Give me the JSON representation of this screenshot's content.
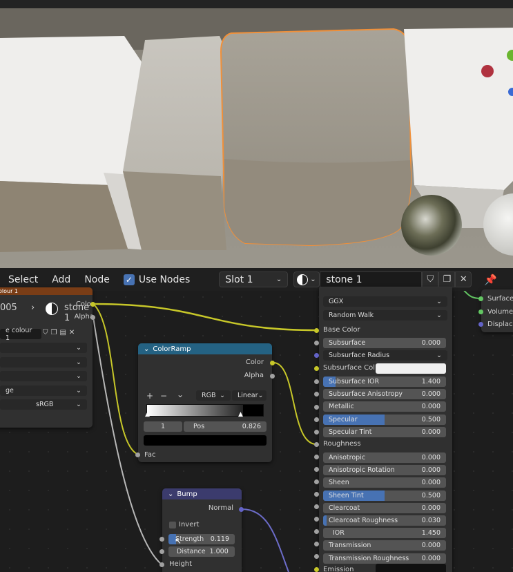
{
  "header": {
    "menus": [
      "Select",
      "Add",
      "Node"
    ],
    "use_nodes_label": "Use Nodes",
    "use_nodes_checked": true,
    "slot_label": "Slot 1",
    "material_name": "stone 1"
  },
  "image_node": {
    "title_partial": "olour 1",
    "id_suffix": "005",
    "name": "stone 1",
    "datablock": "e colour 1",
    "color_space": "sRGB",
    "extension_partial": "ge",
    "outputs": [
      "Color",
      "Alpha"
    ]
  },
  "colorramp": {
    "title": "ColorRamp",
    "outputs": [
      "Color",
      "Alpha"
    ],
    "color_mode": "RGB",
    "interpolation": "Linear",
    "stop_index": "1",
    "pos_label": "Pos",
    "pos_value": "0.826",
    "input_fac": "Fac",
    "controls": [
      "+",
      "−",
      "⌄"
    ]
  },
  "bump": {
    "title": "Bump",
    "output": "Normal",
    "invert_label": "Invert",
    "strength_label": "Strength",
    "strength_value": "0.119",
    "strength_fraction": 0.119,
    "distance_label": "Distance",
    "distance_value": "1.000",
    "input_height": "Height"
  },
  "bsdf": {
    "distribution": "GGX",
    "subsurface_method": "Random Walk",
    "base_color_label": "Base Color",
    "subsurface_radius_label": "Subsurface Radius",
    "subsurface_color_label": "Subsurface Col...",
    "roughness_label": "Roughness",
    "emission_label": "Emission",
    "fields_a": [
      {
        "label": "Subsurface",
        "value": "0.000",
        "fill": 0
      },
      {
        "label": "Subsurface IOR",
        "value": "1.400",
        "fill": 0.1
      },
      {
        "label": "Subsurface Anisotropy",
        "value": "0.000",
        "fill": 0
      },
      {
        "label": "Metallic",
        "value": "0.000",
        "fill": 0
      },
      {
        "label": "Specular",
        "value": "0.500",
        "fill": 0.5
      },
      {
        "label": "Specular Tint",
        "value": "0.000",
        "fill": 0
      }
    ],
    "fields_b": [
      {
        "label": "Anisotropic",
        "value": "0.000",
        "fill": 0
      },
      {
        "label": "Anisotropic Rotation",
        "value": "0.000",
        "fill": 0
      },
      {
        "label": "Sheen",
        "value": "0.000",
        "fill": 0
      },
      {
        "label": "Sheen Tint",
        "value": "0.500",
        "fill": 0.5
      },
      {
        "label": "Clearcoat",
        "value": "0.000",
        "fill": 0
      },
      {
        "label": "Clearcoat Roughness",
        "value": "0.030",
        "fill": 0.03
      },
      {
        "label": "IOR",
        "value": "1.450",
        "fill": 0
      },
      {
        "label": "Transmission",
        "value": "0.000",
        "fill": 0
      },
      {
        "label": "Transmission Roughness",
        "value": "0.000",
        "fill": 0
      }
    ]
  },
  "output_node": {
    "inputs": [
      "Surface",
      "Volume",
      "Displace"
    ]
  },
  "colors": {
    "accent": "#4772b3",
    "socket_color": "#c7c729",
    "socket_gray": "#a1a1a1",
    "socket_vector": "#6363c7",
    "socket_shader": "#63c763",
    "colorramp_header": "#246283",
    "bump_header": "#3b3b6d",
    "image_header": "#7a3d16"
  }
}
